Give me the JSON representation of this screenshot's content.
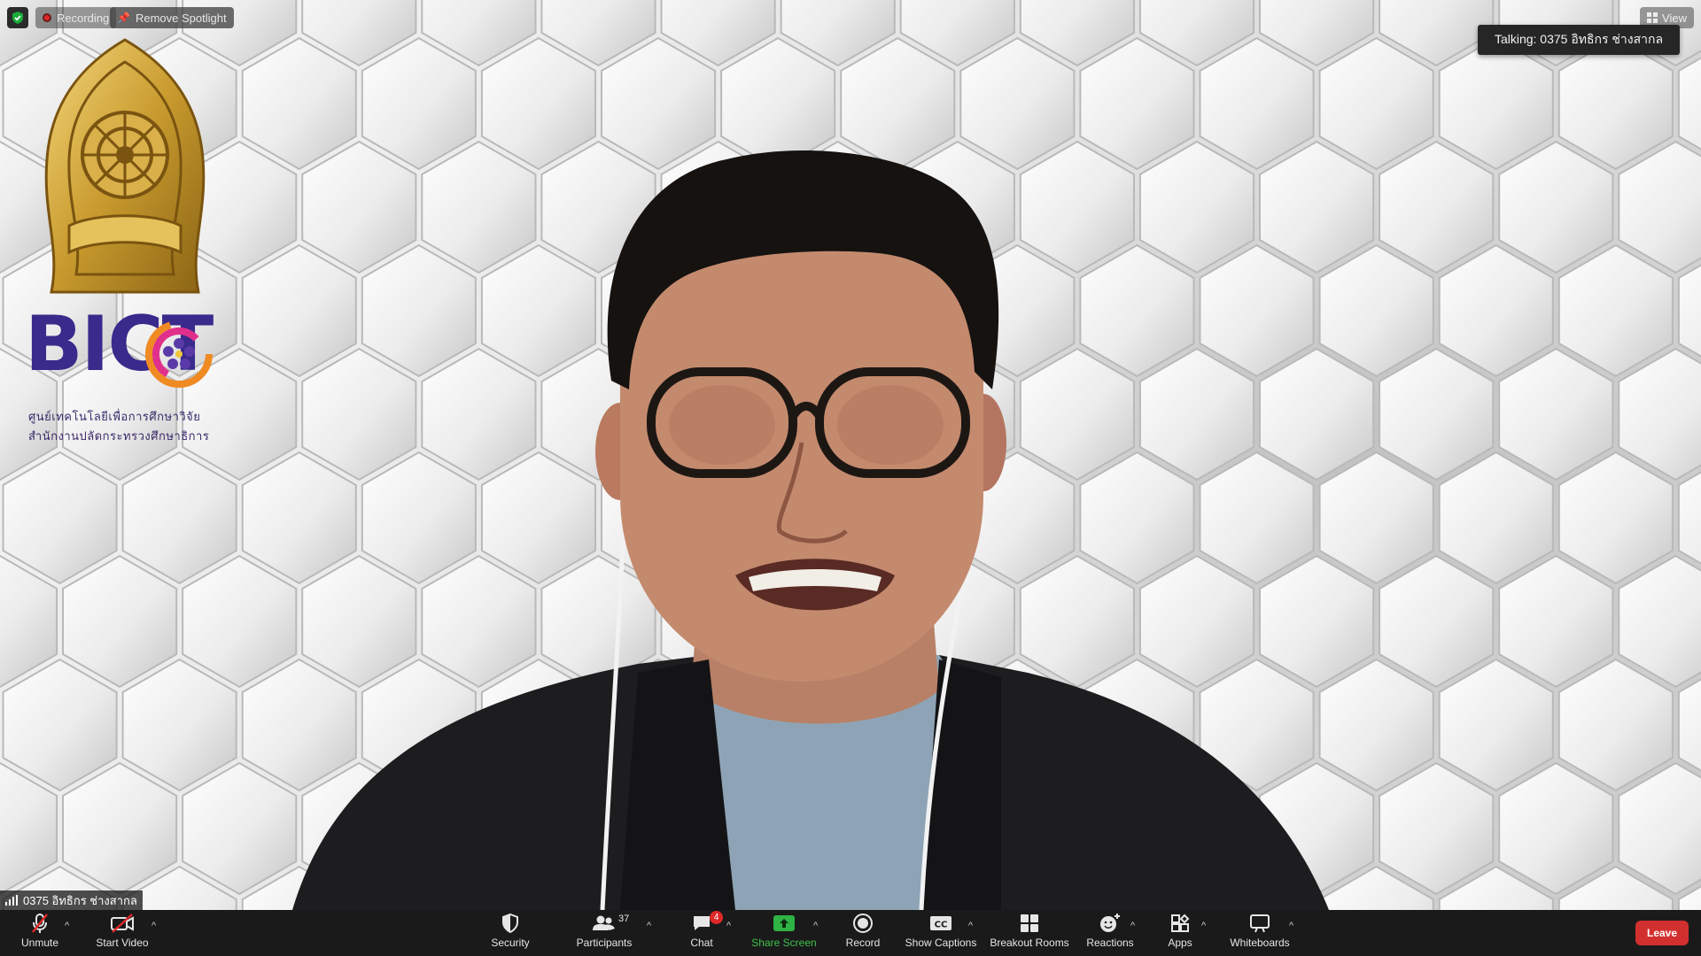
{
  "top_bar": {
    "recording_label": "Recording",
    "remove_spotlight_label": "Remove Spotlight",
    "view_label": "View",
    "talking_text": "Talking: 0375 อิทธิกร ช่างสากล"
  },
  "logos": {
    "org_initials": "BICT",
    "org_name_line1": "ศูนย์เทคโนโลยีเพื่อการศึกษาวิจัย",
    "org_name_line2": "สำนักงานปลัดกระทรวงศึกษาธิการ"
  },
  "participant": {
    "name": "0375 อิทธิกร ช่างสากล"
  },
  "toolbar": {
    "unmute_label": "Unmute",
    "start_video_label": "Start Video",
    "security_label": "Security",
    "participants_label": "Participants",
    "participants_count": "37",
    "chat_label": "Chat",
    "chat_unread": "4",
    "share_screen_label": "Share Screen",
    "record_label": "Record",
    "show_captions_label": "Show Captions",
    "breakout_rooms_label": "Breakout Rooms",
    "reactions_label": "Reactions",
    "apps_label": "Apps",
    "whiteboards_label": "Whiteboards",
    "leave_label": "Leave"
  },
  "colors": {
    "toolbar_bg": "#1a1a1a",
    "leave_red": "#d2302f",
    "share_green": "#3ec24a",
    "recording_red": "#e02828"
  }
}
